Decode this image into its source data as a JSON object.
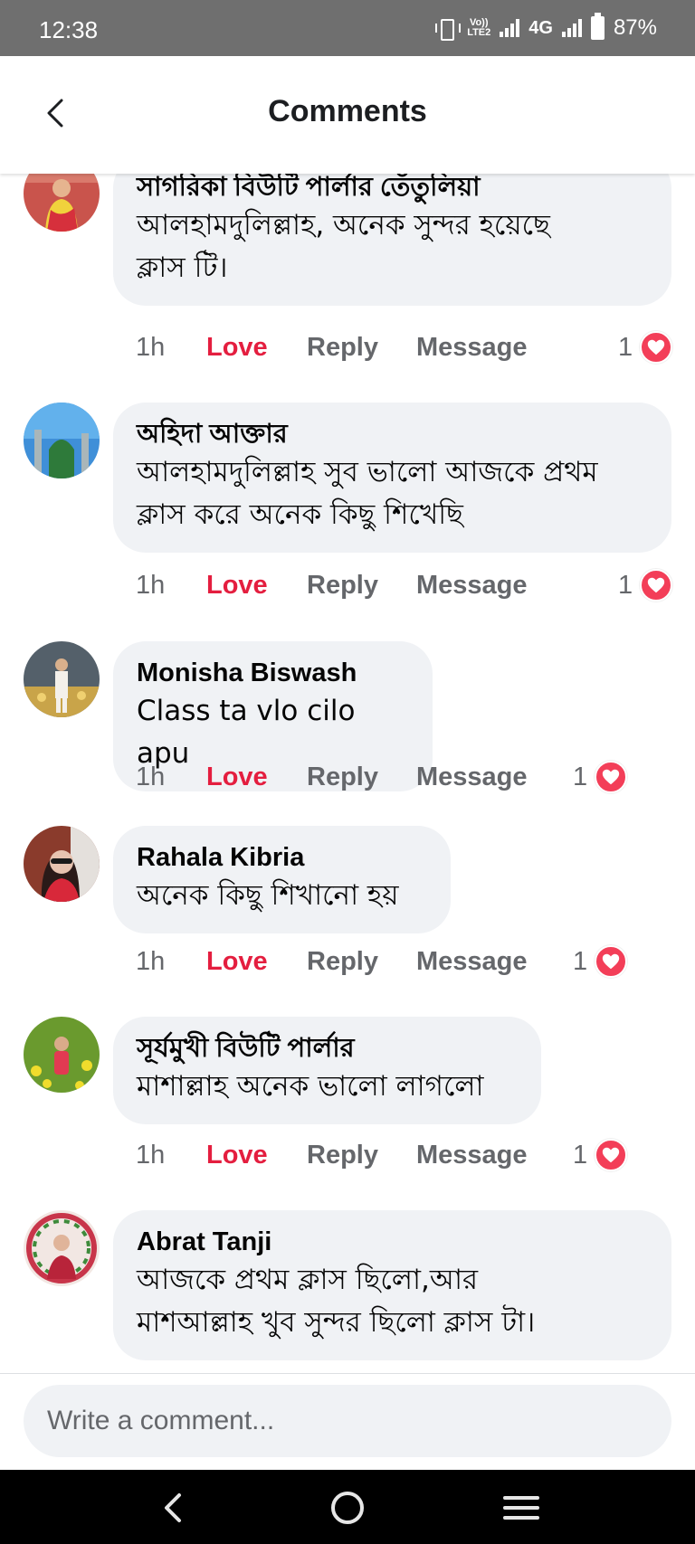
{
  "status_bar": {
    "time": "12:38",
    "volte_top": "Vo))",
    "volte_bottom": "LTE2",
    "network": "4G",
    "battery": "87%"
  },
  "header": {
    "title": "Comments",
    "back_icon": "chevron-left-icon"
  },
  "comments": [
    {
      "author": "সাগরিকা বিউটি পার্লার তেঁতুলিয়া",
      "lines": [
        "আলহামদুলিল্লাহ, অনেক সুন্দর হয়েছে",
        "ক্লাস টি।"
      ],
      "time": "1h",
      "love": "Love",
      "reply": "Reply",
      "message": "Message",
      "reactions": "1"
    },
    {
      "author": "অহিদা আক্তার",
      "lines": [
        "আলহামদুলিল্লাহ সুব ভালো আজকে প্রথম",
        "ক্লাস করে অনেক কিছু শিখেছি"
      ],
      "time": "1h",
      "love": "Love",
      "reply": "Reply",
      "message": "Message",
      "reactions": "1"
    },
    {
      "author": "Monisha Biswash",
      "lines": [
        "Class ta vlo cilo apu"
      ],
      "time": "1h",
      "love": "Love",
      "reply": "Reply",
      "message": "Message",
      "reactions": "1"
    },
    {
      "author": "Rahala Kibria",
      "lines": [
        "অনেক কিছু শিখানো হয়"
      ],
      "time": "1h",
      "love": "Love",
      "reply": "Reply",
      "message": "Message",
      "reactions": "1"
    },
    {
      "author": "সূর্যমুখী বিউটি পার্লার",
      "lines": [
        "মাশাল্লাহ  অনেক ভালো লাগলো"
      ],
      "time": "1h",
      "love": "Love",
      "reply": "Reply",
      "message": "Message",
      "reactions": "1"
    },
    {
      "author": "Abrat Tanji",
      "lines": [
        "আজকে প্রথম ক্লাস ছিলো,আর",
        "মাশআল্লাহ খুব সুন্দর ছিলো ক্লাস টা।"
      ]
    }
  ],
  "composer": {
    "placeholder": "Write a comment..."
  },
  "colors": {
    "love": "#e41e3f",
    "bubble": "#f0f2f5",
    "heart": "#f33e58"
  },
  "navbar": {
    "back_icon": "nav-back-icon",
    "home_icon": "nav-home-icon",
    "recents_icon": "nav-recents-icon"
  }
}
